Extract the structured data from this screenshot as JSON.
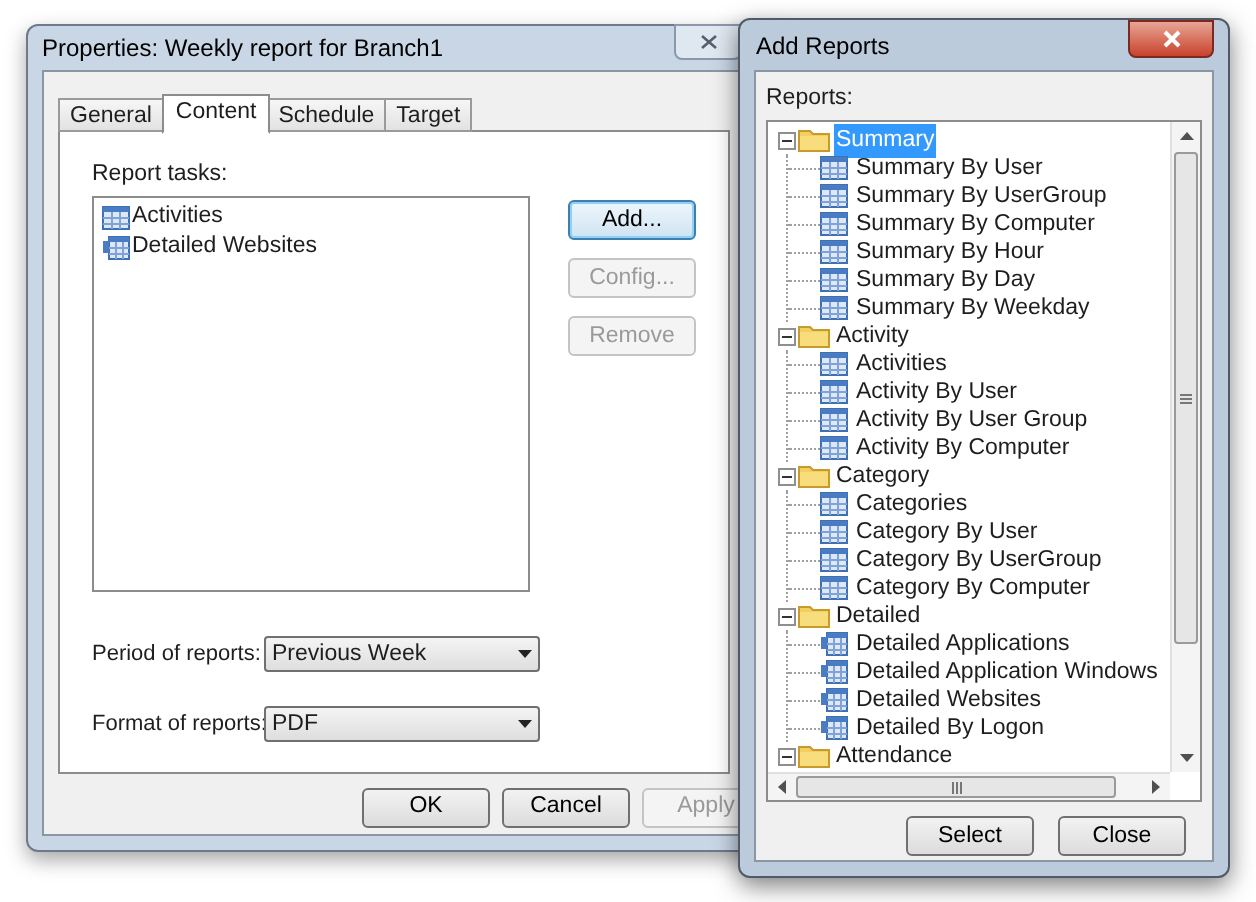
{
  "properties_window": {
    "title": "Properties: Weekly report for Branch1",
    "tabs": [
      {
        "label": "General",
        "selected": false
      },
      {
        "label": "Content",
        "selected": true
      },
      {
        "label": "Schedule",
        "selected": false
      },
      {
        "label": "Target",
        "selected": false
      }
    ],
    "report_tasks": {
      "label": "Report tasks:",
      "items": [
        {
          "label": "Activities",
          "kind": "report",
          "selected": false
        },
        {
          "label": "Detailed Websites",
          "kind": "detailed",
          "selected": false
        }
      ]
    },
    "side_buttons": [
      {
        "label": "Add...",
        "disabled": false,
        "default": true
      },
      {
        "label": "Config...",
        "disabled": true,
        "default": false
      },
      {
        "label": "Remove",
        "disabled": true,
        "default": false
      }
    ],
    "fields": [
      {
        "label": "Period of reports:",
        "value": "Previous Week"
      },
      {
        "label": "Format of reports:",
        "value": "PDF"
      }
    ],
    "buttons": [
      {
        "label": "OK",
        "disabled": false
      },
      {
        "label": "Cancel",
        "disabled": false
      },
      {
        "label": "Apply",
        "disabled": true
      }
    ]
  },
  "add_reports_window": {
    "title": "Add Reports",
    "tree_label": "Reports:",
    "tree": [
      {
        "label": "Summary",
        "expanded": true,
        "selected": true,
        "children": [
          {
            "label": "Summary By User",
            "kind": "report",
            "selected": false
          },
          {
            "label": "Summary By UserGroup",
            "kind": "report",
            "selected": false
          },
          {
            "label": "Summary By Computer",
            "kind": "report",
            "selected": false
          },
          {
            "label": "Summary By Hour",
            "kind": "report",
            "selected": false
          },
          {
            "label": "Summary By Day",
            "kind": "report",
            "selected": false
          },
          {
            "label": "Summary By Weekday",
            "kind": "report",
            "selected": false
          }
        ]
      },
      {
        "label": "Activity",
        "expanded": true,
        "selected": false,
        "children": [
          {
            "label": "Activities",
            "kind": "report",
            "selected": false
          },
          {
            "label": "Activity By User",
            "kind": "report",
            "selected": false
          },
          {
            "label": "Activity By User Group",
            "kind": "report",
            "selected": false
          },
          {
            "label": "Activity By Computer",
            "kind": "report",
            "selected": false
          }
        ]
      },
      {
        "label": "Category",
        "expanded": true,
        "selected": false,
        "children": [
          {
            "label": "Categories",
            "kind": "report",
            "selected": false
          },
          {
            "label": "Category By User",
            "kind": "report",
            "selected": false
          },
          {
            "label": "Category By UserGroup",
            "kind": "report",
            "selected": false
          },
          {
            "label": "Category By Computer",
            "kind": "report",
            "selected": false
          }
        ]
      },
      {
        "label": "Detailed",
        "expanded": true,
        "selected": false,
        "children": [
          {
            "label": "Detailed Applications",
            "kind": "detailed",
            "selected": false
          },
          {
            "label": "Detailed Application Windows",
            "kind": "detailed",
            "selected": false
          },
          {
            "label": "Detailed Websites",
            "kind": "detailed",
            "selected": false
          },
          {
            "label": "Detailed By Logon",
            "kind": "detailed",
            "selected": false
          }
        ]
      },
      {
        "label": "Attendance",
        "expanded": true,
        "selected": false
      }
    ],
    "buttons": [
      {
        "label": "Select",
        "disabled": false
      },
      {
        "label": "Close",
        "disabled": false
      }
    ]
  }
}
